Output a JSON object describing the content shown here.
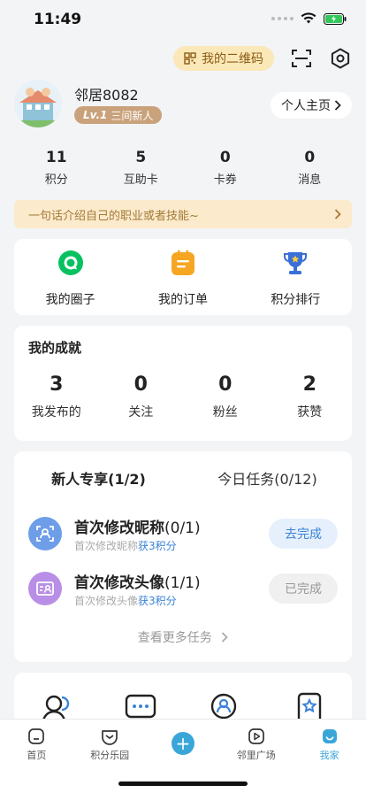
{
  "status_bar": {
    "time": "11:49"
  },
  "header": {
    "qr_label": "我的二维码"
  },
  "profile": {
    "username": "邻居8082",
    "level_badge": "Lv.1",
    "level_title": "三间新人",
    "home_button": "个人主页"
  },
  "stats": [
    {
      "value": "11",
      "label": "积分"
    },
    {
      "value": "5",
      "label": "互助卡"
    },
    {
      "value": "0",
      "label": "卡券"
    },
    {
      "value": "0",
      "label": "消息"
    }
  ],
  "intro_prompt": "一句话介绍自己的职业或者技能~",
  "quick_links": [
    {
      "label": "我的圈子",
      "icon": "chat-bubble-icon"
    },
    {
      "label": "我的订单",
      "icon": "order-list-icon"
    },
    {
      "label": "积分排行",
      "icon": "trophy-icon"
    }
  ],
  "achievements": {
    "title": "我的成就",
    "items": [
      {
        "value": "3",
        "label": "我发布的"
      },
      {
        "value": "0",
        "label": "关注"
      },
      {
        "value": "0",
        "label": "粉丝"
      },
      {
        "value": "2",
        "label": "获赞"
      }
    ]
  },
  "tasks": {
    "tabs": [
      "新人专享(1/2)",
      "今日任务(0/12)"
    ],
    "items": [
      {
        "title": "首次修改昵称",
        "progress": "(0/1)",
        "sub": "首次修改昵称",
        "reward": "获3积分",
        "button": "去完成",
        "status": "todo"
      },
      {
        "title": "首次修改头像",
        "progress": "(1/1)",
        "sub": "首次修改头像",
        "reward": "获3积分",
        "button": "已完成",
        "status": "done"
      }
    ],
    "more": "查看更多任务"
  },
  "tabbar": [
    {
      "label": "首页",
      "icon": "home-icon"
    },
    {
      "label": "积分乐园",
      "icon": "points-park-icon"
    },
    {
      "label": "",
      "icon": "plus-icon"
    },
    {
      "label": "邻里广场",
      "icon": "video-square-icon"
    },
    {
      "label": "我家",
      "icon": "my-home-icon"
    }
  ],
  "colors": {
    "accent": "#3aa6d8",
    "gold": "#c9a27b",
    "green": "#07c160",
    "orange": "#f6a623",
    "blue": "#3a83d8"
  }
}
